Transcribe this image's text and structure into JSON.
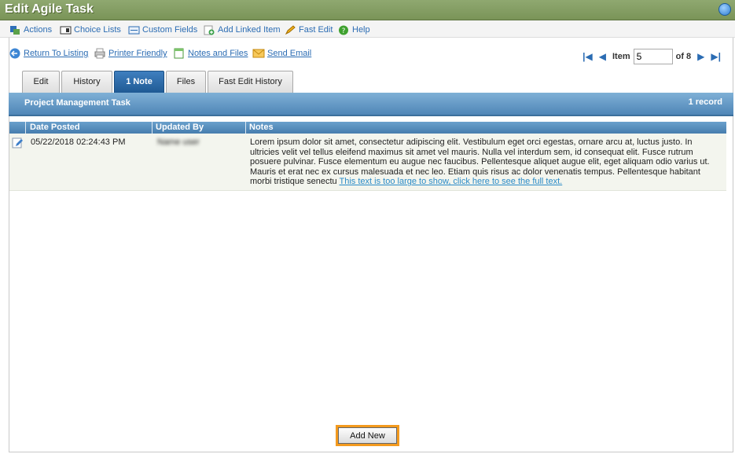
{
  "window": {
    "title": "Edit Agile Task"
  },
  "toolbar": {
    "items": [
      {
        "label": "Actions",
        "icon": "actions-icon"
      },
      {
        "label": "Choice Lists",
        "icon": "list-icon"
      },
      {
        "label": "Custom Fields",
        "icon": "fields-icon"
      },
      {
        "label": "Add Linked Item",
        "icon": "add-link-icon"
      },
      {
        "label": "Fast Edit",
        "icon": "pencil-icon"
      },
      {
        "label": "Help",
        "icon": "help-icon"
      }
    ]
  },
  "links": [
    {
      "label": "Return To Listing",
      "icon": "back-arrow-icon"
    },
    {
      "label": "Printer Friendly",
      "icon": "printer-icon"
    },
    {
      "label": "Notes and Files",
      "icon": "notes-icon"
    },
    {
      "label": "Send Email",
      "icon": "envelope-icon"
    }
  ],
  "pager": {
    "item_label": "Item",
    "item_value": "5",
    "of_label": "of 8"
  },
  "tabs": [
    {
      "label": "Edit",
      "active": false
    },
    {
      "label": "History",
      "active": false
    },
    {
      "label": "1 Note",
      "active": true
    },
    {
      "label": "Files",
      "active": false
    },
    {
      "label": "Fast Edit History",
      "active": false
    }
  ],
  "section": {
    "title": "Project Management Task",
    "count": "1 record"
  },
  "grid": {
    "columns": [
      "Date Posted",
      "Updated By",
      "Notes"
    ],
    "rows": [
      {
        "date_posted": "05/22/2018 02:24:43 PM",
        "updated_by": "Name user",
        "notes": "Lorem ipsum dolor sit amet, consectetur adipiscing elit. Vestibulum eget orci egestas, ornare arcu at, luctus justo. In ultricies velit vel tellus eleifend maximus sit amet vel mauris. Nulla vel interdum sem, id consequat elit. Fusce rutrum posuere pulvinar. Fusce elementum eu augue nec faucibus. Pellentesque aliquet augue elit, eget aliquam odio varius ut. Mauris et erat nec ex cursus malesuada et nec leo. Etiam quis risus ac dolor venenatis tempus. Pellentesque habitant morbi tristique senectu",
        "more_link": "This text is too large to show, click here to see the full text."
      }
    ]
  },
  "add_new_label": "Add New",
  "colors": {
    "title_bar": "#7a9458",
    "section_bar": "#4f86b7",
    "active_tab": "#1f5a94",
    "link": "#2b6cb3",
    "highlight": "#f39a1e"
  }
}
